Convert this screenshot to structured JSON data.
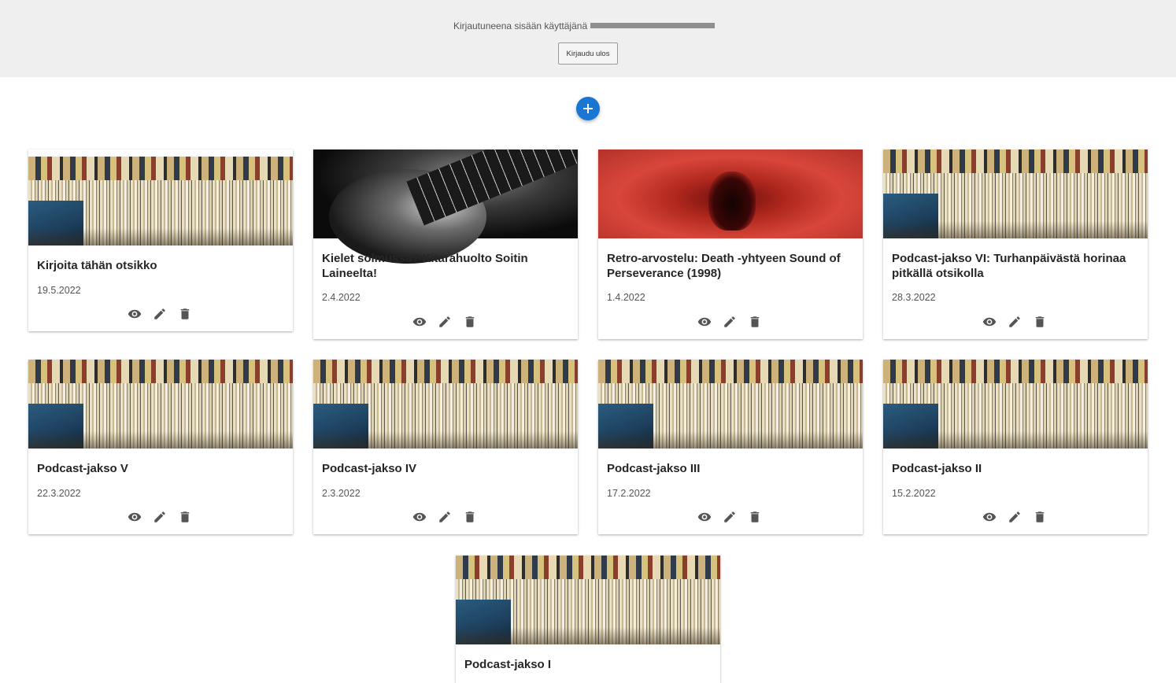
{
  "header": {
    "logged_in_label": "Kirjautuneena sisään käyttäjänä",
    "logout_button": "Kirjaudu ulos"
  },
  "add_button": {
    "icon": "plus-icon"
  },
  "actions": {
    "view_icon": "eye-icon",
    "edit_icon": "pencil-icon",
    "delete_icon": "trash-icon"
  },
  "posts": [
    {
      "title": "Kirjoita tähän otsikko",
      "date": "19.5.2022",
      "image": "record-store"
    },
    {
      "title": "Kielet solmussa? Kitarahuolto Soitin Laineelta!",
      "date": "2.4.2022",
      "image": "guitar"
    },
    {
      "title": "Retro-arvostelu: Death -yhtyeen Sound of Perseverance (1998)",
      "date": "1.4.2022",
      "image": "red-album-art"
    },
    {
      "title": "Podcast-jakso VI: Turhanpäivästä horinaa pitkällä otsikolla",
      "date": "28.3.2022",
      "image": "record-store"
    },
    {
      "title": "Podcast-jakso V",
      "date": "22.3.2022",
      "image": "record-store"
    },
    {
      "title": "Podcast-jakso IV",
      "date": "2.3.2022",
      "image": "record-store"
    },
    {
      "title": "Podcast-jakso III",
      "date": "17.2.2022",
      "image": "record-store"
    },
    {
      "title": "Podcast-jakso II",
      "date": "15.2.2022",
      "image": "record-store"
    },
    {
      "title": "Podcast-jakso I",
      "date": "",
      "image": "record-store"
    }
  ]
}
